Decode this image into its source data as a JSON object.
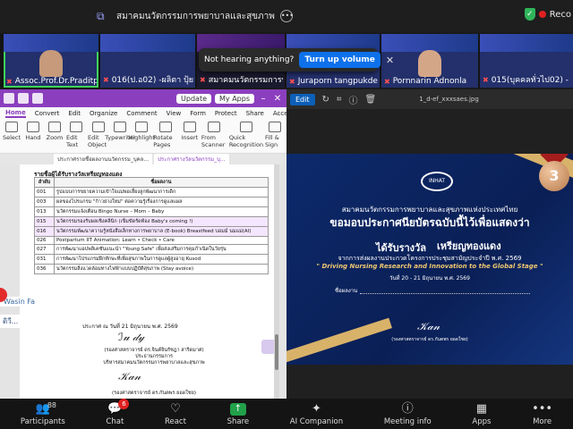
{
  "zoom": {
    "share_title": "สมาคมนวัตกรรมการพยาบาลและสุขภาพ",
    "recording_label": "Reco"
  },
  "gallery": {
    "tiles": [
      {
        "name": "Assoc.Prof.Dr.Praditpo"
      },
      {
        "name": "016(ป.อ02) -ผลิตา ปุ้ยผิน"
      },
      {
        "name": "สมาคมนวัตกรรมการพยาบาล"
      },
      {
        "name": "Juraporn tangpukdee.k"
      },
      {
        "name": "Pornnarin Adnonla"
      },
      {
        "name": "015(บุคคลทั่วไป02) - นาง"
      }
    ],
    "toast_text": "Not hearing anything?",
    "toast_button": "Turn up volume"
  },
  "pdf": {
    "update_label": "Update",
    "myapps_label": "My Apps",
    "menu": [
      "Home",
      "Convert",
      "Edit",
      "Organize",
      "Comment",
      "View",
      "Form",
      "Protect",
      "Share",
      "Accessibility"
    ],
    "ribbon": [
      "Select",
      "Hand",
      "Zoom",
      "Edit Text",
      "Edit Object",
      "Typewriter",
      "Highlight",
      "Rotate Pages",
      "Insert",
      "From Scanner",
      "Quick Recognition",
      "Fill & Sign"
    ],
    "tabs": [
      "ประกาศรายชื่อผลงานนวัตกรรม_บุคล...",
      "ประกาศรางวัลนวัตกรรม_บุ..."
    ],
    "heading": "รายชื่อผู้ได้รับรางวัลเหรียญทองแดง",
    "table_header": [
      "ลำดับ",
      "ชื่อผลงาน"
    ],
    "rows": [
      {
        "no": "001",
        "title": "รูปแบบการขยายความเข้าใจแม่พ่อเลี้ยงลูกพัฒนาการเด็ก",
        "hl": false
      },
      {
        "no": "003",
        "title": "ผลของโปรแกรม \"ก้าวย่างใหม่\" ต่อความรู้เรื่องการดูแลแผล",
        "hl": false
      },
      {
        "no": "013",
        "title": "นวัตกรรมแจ้งเตือน Bingo Nurse – Mom – Baby",
        "hl": false
      },
      {
        "no": "015",
        "title": "นวัตกรรมรองรับผลเชิงคลินิก (เข็มขัดรัดท้อง Baby's coming !)",
        "hl": true
      },
      {
        "no": "016",
        "title": "นวัตกรรมพัฒนาความรู้หนังสือเล็กทางการพยาบาล (E-book) Breastfeed  บอมม์ นมแม่(AI)",
        "hl": true
      },
      {
        "no": "026",
        "title": "Postpartum IIT Animation: Learn • Check • Care",
        "hl": false
      },
      {
        "no": "027",
        "title": "การพัฒนาแอปพลิเคชันแนะนำ \"Young Safe\" เพื่อส่งเสริมการคุมกำเนิดในวัยรุ่น",
        "hl": false
      },
      {
        "no": "031",
        "title": "การพัฒนาโปรแกรมฝึกทักษะที่เพื่อสุขภาพในการดูแลผู้สูงอายุ Kusod",
        "hl": false
      },
      {
        "no": "036",
        "title": "นวัตกรรมสิ่งแวดล้อมทางไฟฟ้าแบบปฏิบัติสุขภาพ (Stay avoice)",
        "hl": false
      }
    ],
    "announce": "ประกาศ ณ วันที่ 21 มิถุนายน พ.ศ. 2569",
    "sign1": "(รองศาสตราจารย์ ดร.จินต์จินรัชฎา สาริดมาศ)",
    "sign1_role": "ประธานกรรมการ",
    "sign1_org": "บริหารสมาคมนวัตกรรมการพยาบาลและสุขภาพ",
    "sign2": "(รองศาสตราจารย์ ดร.กันตพร ยอดใชย)",
    "side_label": "Wasin  Fa",
    "side_dots": "ดิวี..."
  },
  "viewer": {
    "edit_label": "Edit",
    "filename": "1_d-ef_xxxsaes.jpg",
    "cert": {
      "logo": "INHAT",
      "org": "สมาคมนวัตกรรมการพยาบาลและสุขภาพแห่งประเทศไทย",
      "line2": "ขอมอบประกาศนียบัตรฉบับนี้ไว้เพื่อแสดงว่า",
      "award": "ได้รับรางวัล",
      "award_name": "เหรียญทองแดง",
      "desc": "จากการส่งผลงานประกวดโครงการประชุมสามัญประจำปี พ.ศ. 2569",
      "theme": "\" Driving Nursing Research and Innovation to the Global Stage \"",
      "dates": "วันที่ 20 - 21 มิถุนายน พ.ศ. 2569",
      "proj_label": "ชื่อผลงาน",
      "sign": "(รองศาสตราจารย์ ดร.กันตพร ยอดใชย)",
      "medal": "3"
    }
  },
  "toolbar": {
    "participants": "Participants",
    "participant_count": "88",
    "chat": "Chat",
    "chat_badge": "6",
    "react": "React",
    "share": "Share",
    "companion": "AI Companion",
    "meeting_info": "Meeting info",
    "apps": "Apps",
    "more": "More"
  }
}
